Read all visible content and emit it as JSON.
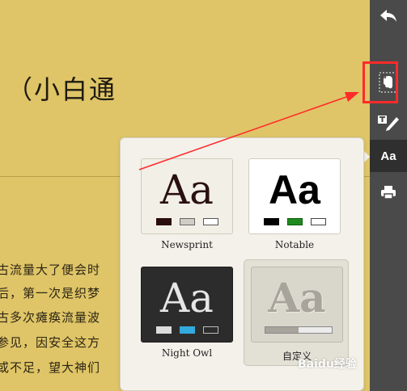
{
  "article": {
    "title": "（小白通",
    "lines": [
      "古流量大了便会时",
      "后，第一次是织梦",
      "古多次瘫痪流量波",
      "参见，因安全这方",
      "或不足，望大神们"
    ]
  },
  "toolbar": {
    "aa_label": "Aa",
    "icons": [
      "back-arrow-icon",
      "evernote-icon",
      "text-edit-icon",
      "font-size-icon",
      "print-icon"
    ]
  },
  "theme_panel": {
    "themes": [
      {
        "name": "Newsprint",
        "aa": "Aa",
        "bg": "#f2efe6",
        "fg": "#2a1010",
        "swatches": [
          "#2a0d0d",
          "#d0ccc6",
          "#ffffff"
        ],
        "swatch_borders": [
          "#2a0d0d",
          "#666666",
          "#555555"
        ]
      },
      {
        "name": "Notable",
        "aa": "Aa",
        "bg": "#ffffff",
        "fg": "#000000",
        "swatches": [
          "#000000",
          "#1f8b1f",
          "#ffffff"
        ],
        "swatch_borders": [
          "#000000",
          "#0d5d0d",
          "#444444"
        ]
      },
      {
        "name": "Night Owl",
        "aa": "Aa",
        "bg": "#2c2c2c",
        "fg": "#e6e6e6",
        "swatches": [
          "#dcdcdc",
          "#33aadd",
          "#2c2c2c"
        ],
        "swatch_borders": [
          "#dcdcdc",
          "#33aadd",
          "#bbbbbb"
        ]
      },
      {
        "name": "自定义",
        "aa": "Aa",
        "bg": "#d9d6cc",
        "fg": "#a8a39b",
        "progress": 0.5
      }
    ]
  },
  "annotation": {
    "color": "#ff2a2a"
  },
  "watermark": "Baidu经验"
}
